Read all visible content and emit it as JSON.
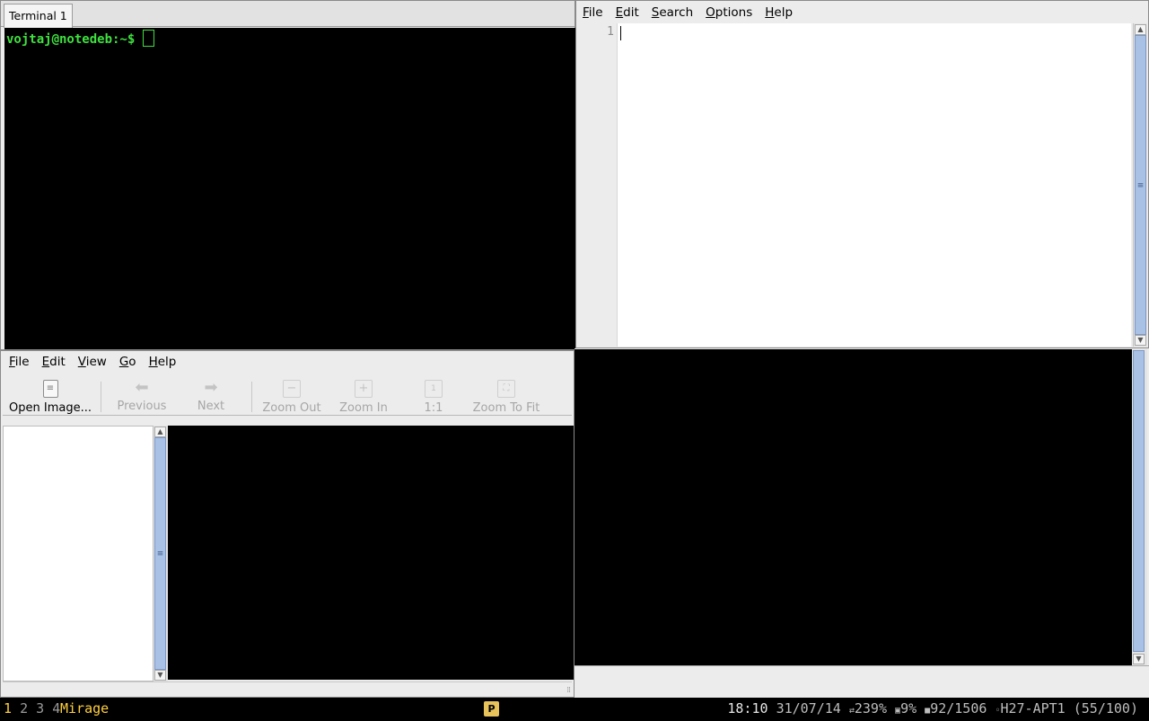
{
  "terminal": {
    "tab_label": "Terminal 1",
    "prompt": "vojtaj@notedeb:~$"
  },
  "editor": {
    "menu": [
      "File",
      "Edit",
      "Search",
      "Options",
      "Help"
    ],
    "line_number": "1"
  },
  "viewer": {
    "menu": [
      "File",
      "Edit",
      "View",
      "Go",
      "Help"
    ],
    "toolbar": {
      "open": "Open Image...",
      "previous": "Previous",
      "next": "Next",
      "zoom_out": "Zoom Out",
      "zoom_in": "Zoom In",
      "one_to_one": "1:1",
      "zoom_to_fit": "Zoom To Fit"
    }
  },
  "statusbar": {
    "workspaces": [
      "1",
      "2",
      "3",
      "4"
    ],
    "active_workspace": "1",
    "window_title": "Mirage",
    "tray_icon": "P",
    "clock": "18:10",
    "date": "31/07/14",
    "network": "239%",
    "cpu": "9%",
    "memory": "92/1506",
    "wifi": "H27-APT1 (55/100)"
  }
}
